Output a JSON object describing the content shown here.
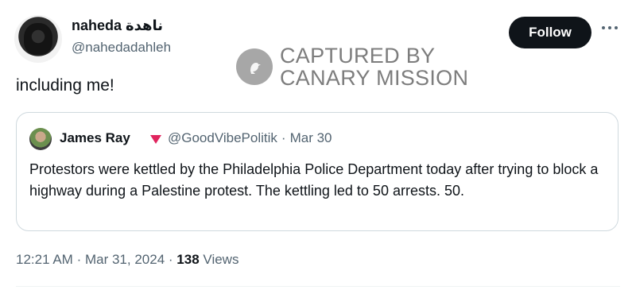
{
  "author": {
    "display_name": "naheda ناهدة",
    "handle": "@nahedadahleh"
  },
  "actions": {
    "follow_label": "Follow"
  },
  "watermark": {
    "line1": "CAPTURED BY",
    "line2": "CANARY MISSION"
  },
  "tweet": {
    "text": "including me!"
  },
  "quoted_tweet": {
    "author_name": "James Ray",
    "handle": "@GoodVibePolitik",
    "separator": "·",
    "date": "Mar 30",
    "text": "Protestors were kettled by the Philadelphia Police Department today after trying to block a highway during a Palestine protest. The kettling led to 50 arrests. 50."
  },
  "meta": {
    "time": "12:21 AM",
    "separator": "·",
    "date": "Mar 31, 2024",
    "views_count": "138",
    "views_label": "Views"
  },
  "icons": {
    "more": "more-horizontal-icon",
    "verified_marker": "red-triangle-icon",
    "watermark_logo": "canary-bird-icon"
  },
  "colors": {
    "text_primary": "#0f1419",
    "text_secondary": "#536471",
    "follow_bg": "#0f1419",
    "border": "#cfd9de",
    "marker": "#e0245e"
  }
}
